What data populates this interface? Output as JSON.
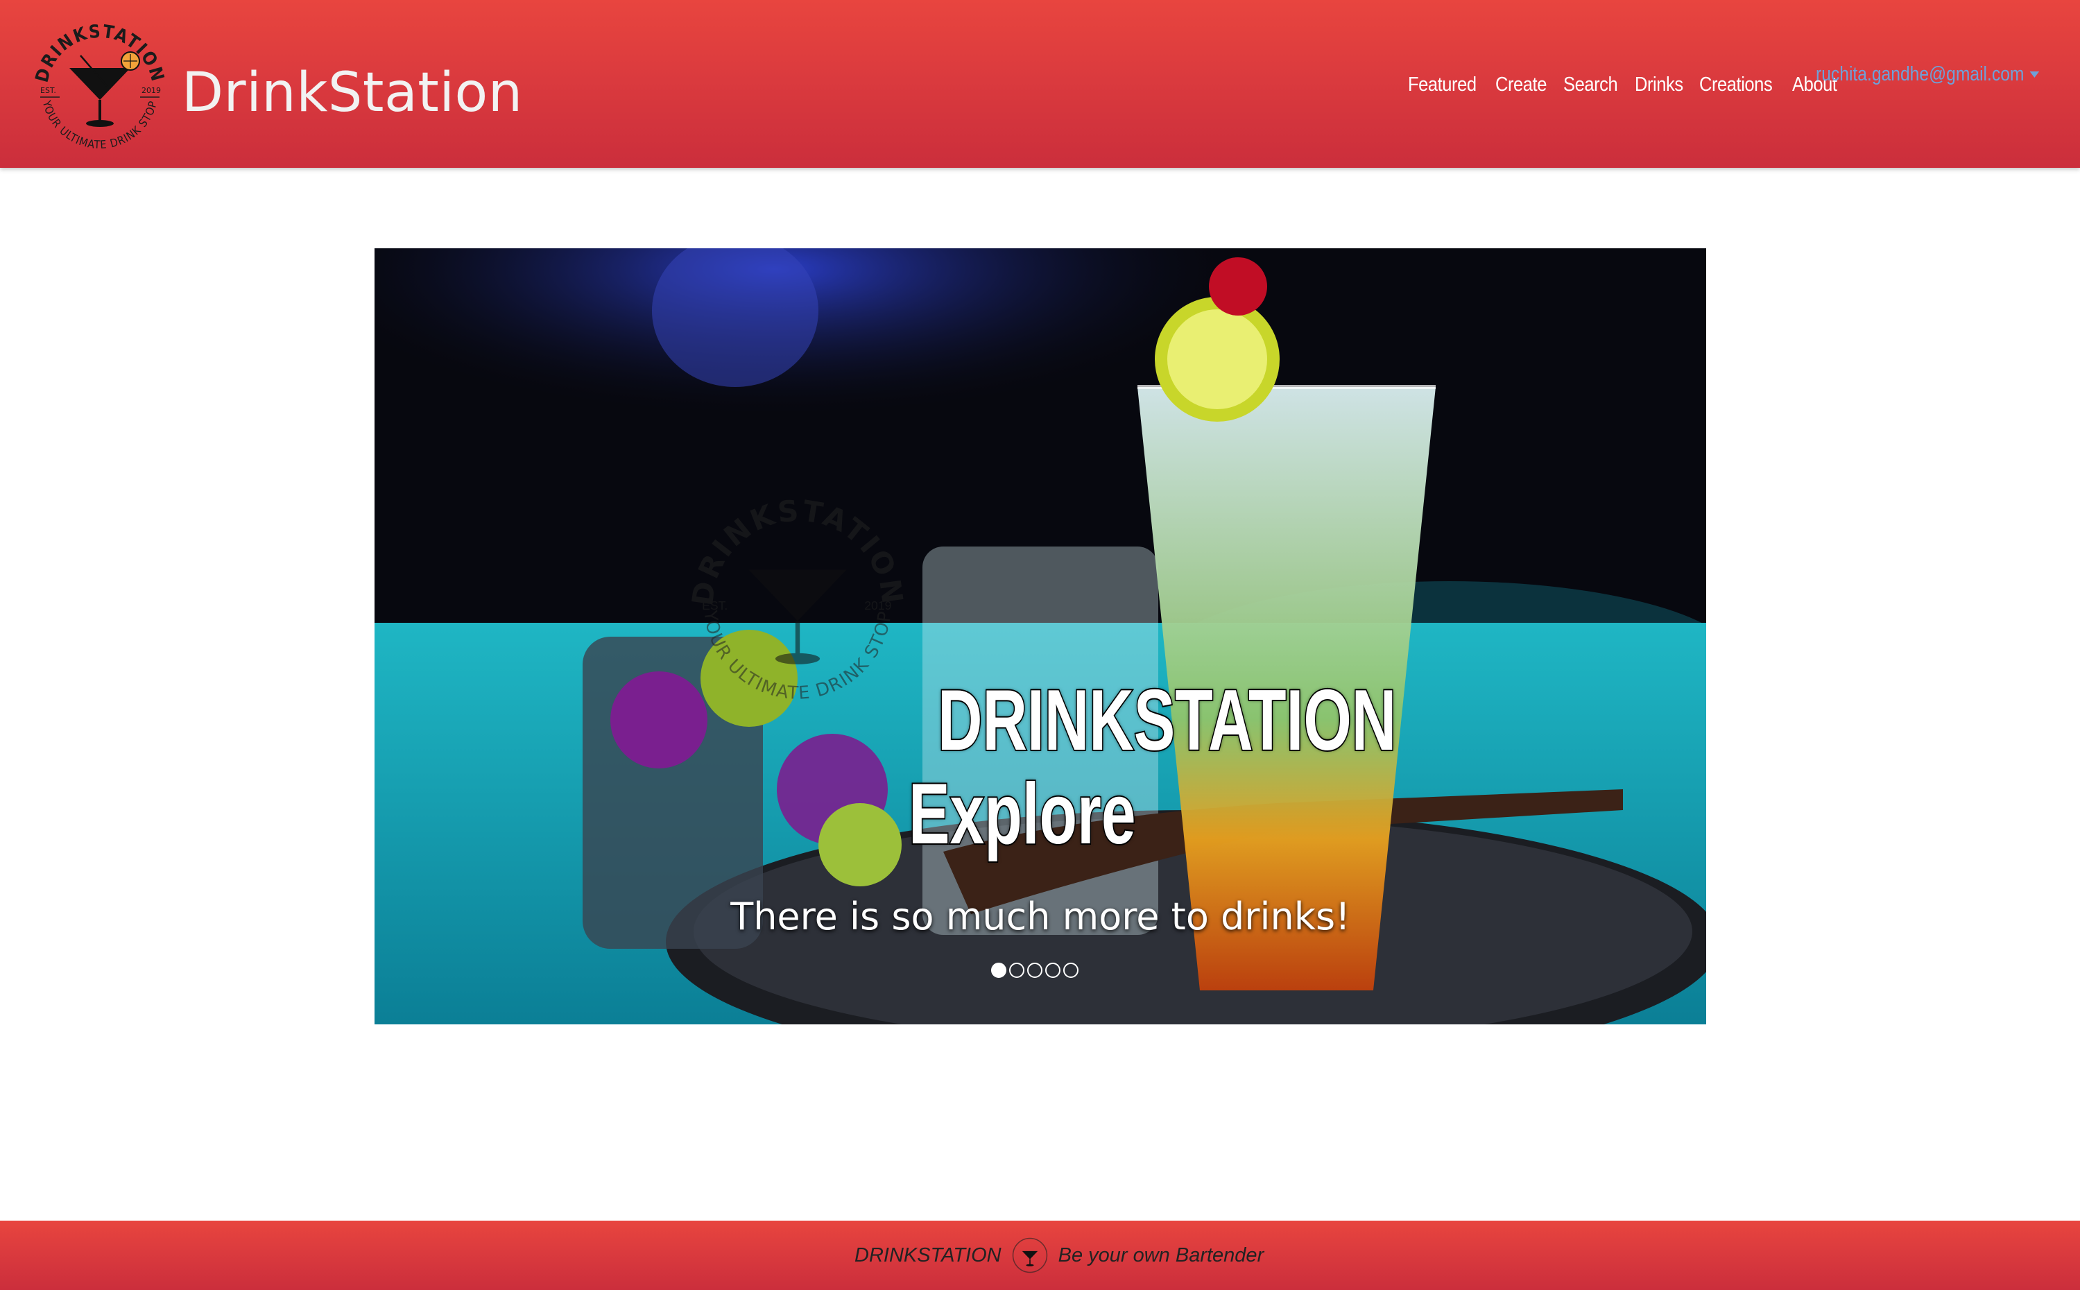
{
  "header": {
    "brand": "DrinkStation",
    "logo": {
      "icon": "drinkstation-logo-icon",
      "arc_top": "DRINKSTATION",
      "arc_bottom": "YOUR ULTIMATE DRINK STOP",
      "est": "EST.",
      "year": "2019"
    },
    "nav": [
      "Featured",
      "Create",
      "Search",
      "Drinks",
      "Creations",
      "About"
    ],
    "user_email": "ruchita.gandhe@gmail.com",
    "user_menu_icon": "caret-down-icon"
  },
  "carousel": {
    "headline": "DRINKSTATION",
    "subheadline": "Explore",
    "tagline": "There is so much more to drinks!",
    "slide_count": 5,
    "active_slide": 1
  },
  "footer": {
    "brand": "DRINKSTATION",
    "logo_icon": "drinkstation-logo-icon",
    "tagline": "Be your own Bartender"
  },
  "colors": {
    "header_red": "#e8453f",
    "header_red_dark": "#cb2e3c",
    "user_link_blue": "#6fa0d8"
  }
}
